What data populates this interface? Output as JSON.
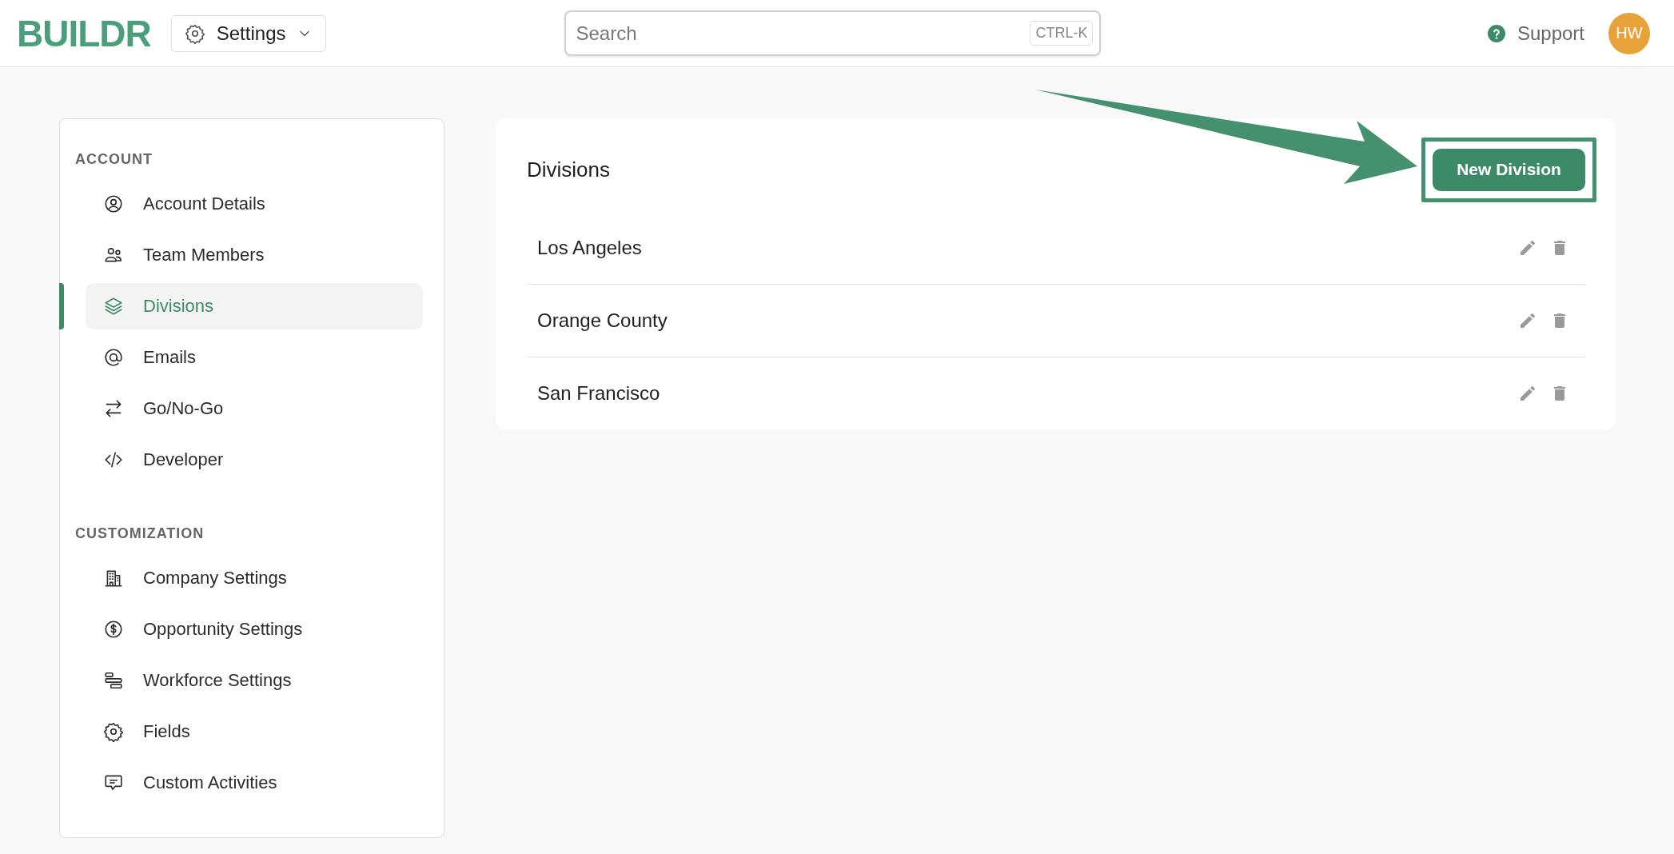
{
  "header": {
    "logo": "BUILDR",
    "menu": {
      "label": "Settings"
    },
    "search": {
      "placeholder": "Search",
      "shortcut": "CTRL-K"
    },
    "support": "Support",
    "avatar": "HW"
  },
  "sidebar": {
    "sections": [
      {
        "title": "ACCOUNT",
        "items": [
          {
            "label": "Account Details",
            "selected": false
          },
          {
            "label": "Team Members",
            "selected": false
          },
          {
            "label": "Divisions",
            "selected": true
          },
          {
            "label": "Emails",
            "selected": false
          },
          {
            "label": "Go/No-Go",
            "selected": false
          },
          {
            "label": "Developer",
            "selected": false
          }
        ]
      },
      {
        "title": "CUSTOMIZATION",
        "items": [
          {
            "label": "Company Settings",
            "selected": false
          },
          {
            "label": "Opportunity Settings",
            "selected": false
          },
          {
            "label": "Workforce Settings",
            "selected": false
          },
          {
            "label": "Fields",
            "selected": false
          },
          {
            "label": "Custom Activities",
            "selected": false
          }
        ]
      }
    ]
  },
  "panel": {
    "title": "Divisions",
    "button": "New Division",
    "rows": [
      {
        "name": "Los Angeles"
      },
      {
        "name": "Orange County"
      },
      {
        "name": "San Francisco"
      }
    ]
  },
  "annotations": {
    "arrow": true,
    "highlight_frame": true
  }
}
